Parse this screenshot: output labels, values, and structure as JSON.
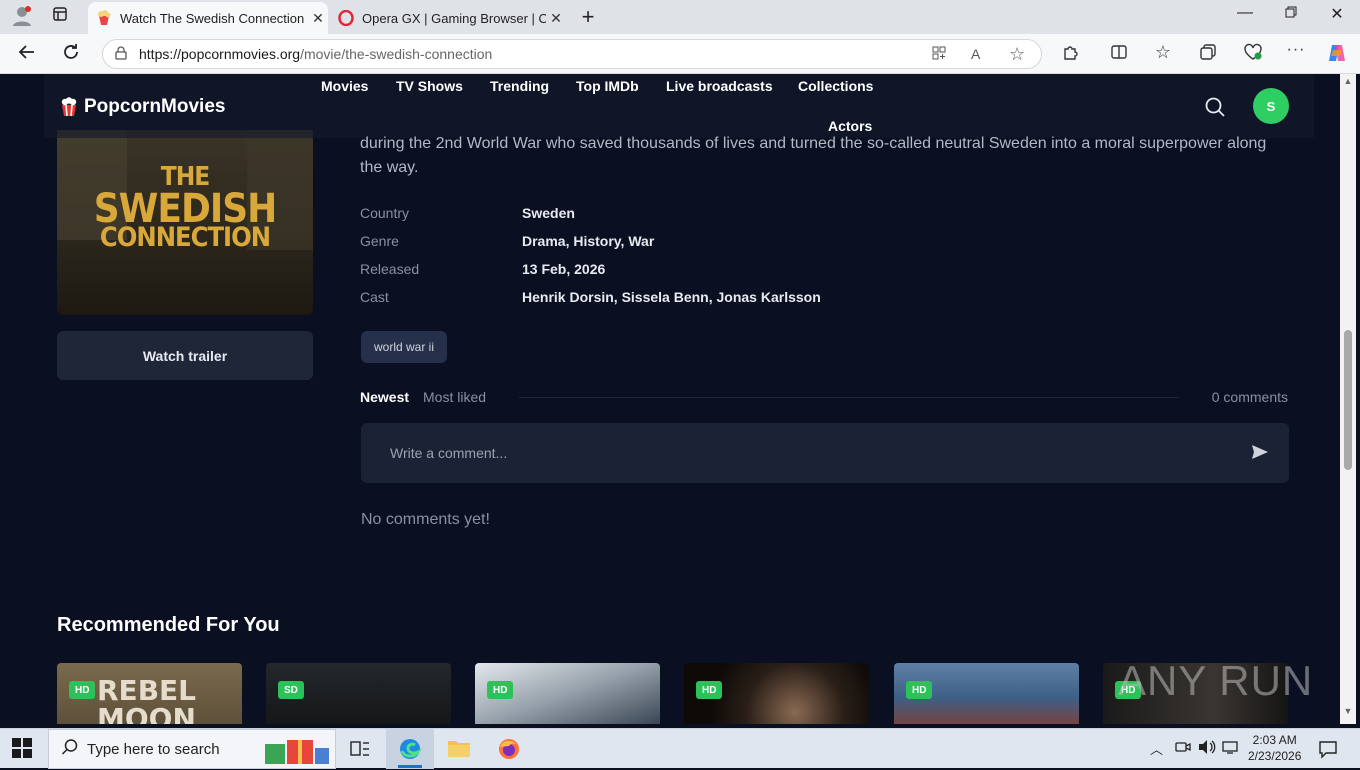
{
  "browser": {
    "tabs": [
      {
        "title": "Watch The Swedish Connection O",
        "active": true
      },
      {
        "title": "Opera GX | Gaming Browser | Ope",
        "active": false
      }
    ],
    "url_host": "https://popcornmovies.org",
    "url_path": "/movie/the-swedish-connection"
  },
  "site": {
    "logo": "PopcornMovies",
    "nav": [
      "Movies",
      "TV Shows",
      "Trending",
      "Top IMDb",
      "Live broadcasts",
      "Collections",
      "Actors"
    ],
    "avatar_letter": "S"
  },
  "movie": {
    "poster_lines": [
      "THE",
      "SWEDISH",
      "CONNECTION"
    ],
    "description": "during the 2nd World War who saved thousands of lives and turned the so-called neutral Sweden into a moral superpower along the way.",
    "meta": [
      {
        "key": "Country",
        "value": "Sweden"
      },
      {
        "key": "Genre",
        "value": "Drama,  History,  War"
      },
      {
        "key": "Released",
        "value": "13 Feb, 2026"
      },
      {
        "key": "Cast",
        "value": "Henrik Dorsin,  Sissela Benn,  Jonas Karlsson"
      }
    ],
    "trailer_button": "Watch trailer",
    "tag": "world war ii"
  },
  "comments": {
    "tab_newest": "Newest",
    "tab_most_liked": "Most liked",
    "count": "0 comments",
    "placeholder": "Write a comment...",
    "empty": "No comments yet!"
  },
  "recommended": {
    "title": "Recommended For You",
    "cards": [
      {
        "badge": "HD",
        "poster_text": "REBEL MOON",
        "color": "#6b5d44"
      },
      {
        "badge": "SD",
        "poster_text": "",
        "color": "#1a1d1f"
      },
      {
        "badge": "HD",
        "poster_text": "",
        "color": "#9aa4ad"
      },
      {
        "badge": "HD",
        "poster_text": "",
        "color": "#1a1410"
      },
      {
        "badge": "HD",
        "poster_text": "",
        "color": "#3e5f86"
      },
      {
        "badge": "HD",
        "poster_text": "",
        "color": "#141414"
      }
    ]
  },
  "watermark": "ANY RUN",
  "taskbar": {
    "search_placeholder": "Type here to search",
    "time": "2:03 AM",
    "date": "2/23/2026"
  },
  "colors": {
    "accent_green": "#2fce63",
    "badge_green": "#2bc25a",
    "page_bg": "#0a0f22"
  }
}
